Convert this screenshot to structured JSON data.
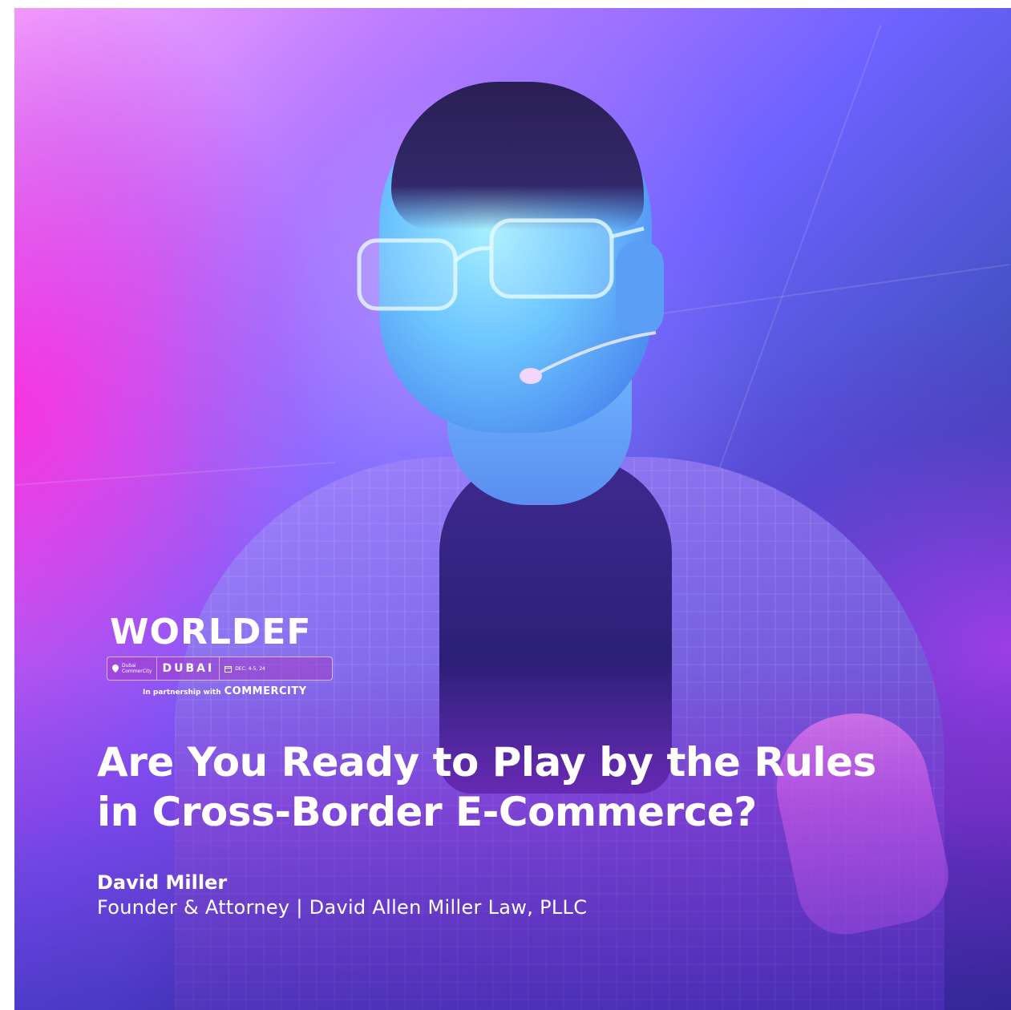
{
  "logo": {
    "wordmark": "WORLDEF",
    "location_line1": "Dubai",
    "location_line2": "CommerCity",
    "city": "DUBAI",
    "date": "DEC. 4-5, 24",
    "partner_text": "In partnership with",
    "partner_brand": "COMMERCITY"
  },
  "headline": {
    "line1": "Are You Ready to Play by the Rules",
    "line2": "in Cross-Border E-Commerce?"
  },
  "speaker": {
    "name": "David Miller",
    "title": "Founder & Attorney | David Allen Miller Law, PLLC"
  },
  "colors": {
    "accent_pink": "#ff28dc",
    "accent_purple": "#8a4fe0",
    "deep_blue": "#2b2f82",
    "text": "#ffffff"
  }
}
